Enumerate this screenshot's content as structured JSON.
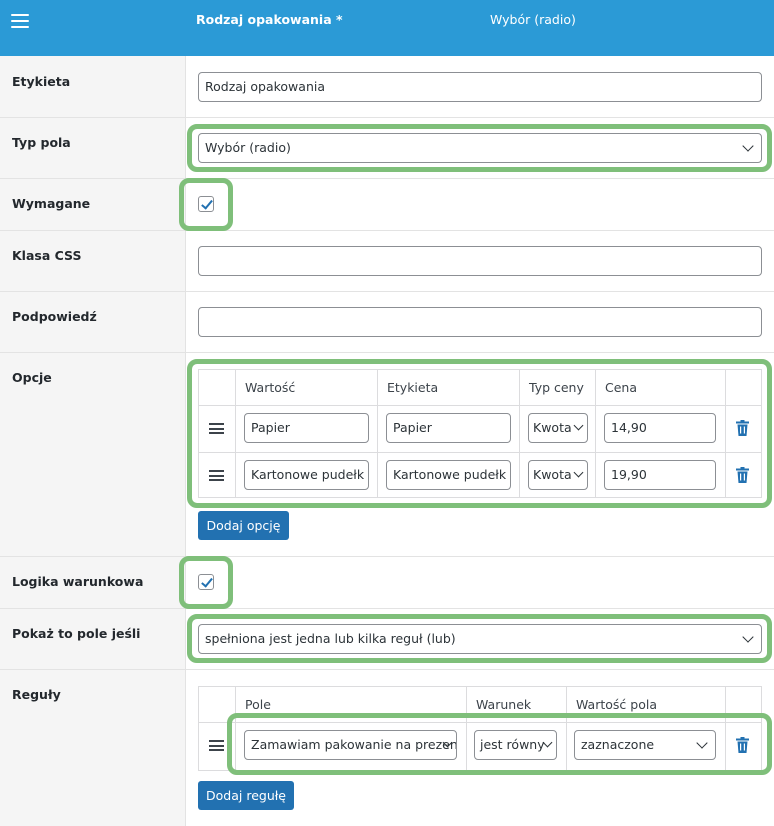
{
  "header": {
    "title": "Rodzaj opakowania *",
    "field_type": "Wybór (radio)"
  },
  "labels": {
    "etykieta": "Etykieta",
    "typ_pola": "Typ pola",
    "wymagane": "Wymagane",
    "klasa_css": "Klasa CSS",
    "podpowiedz": "Podpowiedź",
    "opcje": "Opcje",
    "logika": "Logika warunkowa",
    "pokaz": "Pokaż to pole jeśli",
    "reguly": "Reguły"
  },
  "fields": {
    "etykieta_value": "Rodzaj opakowania",
    "typ_pola_value": "Wybór (radio)",
    "wymagane_checked": true,
    "klasa_css_value": "",
    "podpowiedz_value": "",
    "logika_checked": true,
    "pokaz_value": "spełniona jest jedna lub kilka reguł (lub)"
  },
  "options_table": {
    "headers": [
      "Wartość",
      "Etykieta",
      "Typ ceny",
      "Cena"
    ],
    "rows": [
      {
        "value": "Papier",
        "label": "Papier",
        "price_type": "Kwota",
        "price": "14,90"
      },
      {
        "value": "Kartonowe pudełk",
        "label": "Kartonowe pudełk",
        "price_type": "Kwota",
        "price": "19,90"
      }
    ],
    "add_button": "Dodaj opcję"
  },
  "rules_table": {
    "headers": [
      "Pole",
      "Warunek",
      "Wartość pola"
    ],
    "rows": [
      {
        "field": "Zamawiam pakowanie na prezen",
        "condition": "jest równy",
        "value": "zaznaczone"
      }
    ],
    "add_button": "Dodaj regułę"
  },
  "colors": {
    "header": "#2b9ad6",
    "button": "#2271b1",
    "highlight": "#7fbf7a",
    "trash": "#2271b1"
  },
  "icons": [
    "hamburger-menu-icon",
    "chevron-down-icon",
    "checkmark-icon",
    "drag-handle-icon",
    "trash-icon"
  ]
}
